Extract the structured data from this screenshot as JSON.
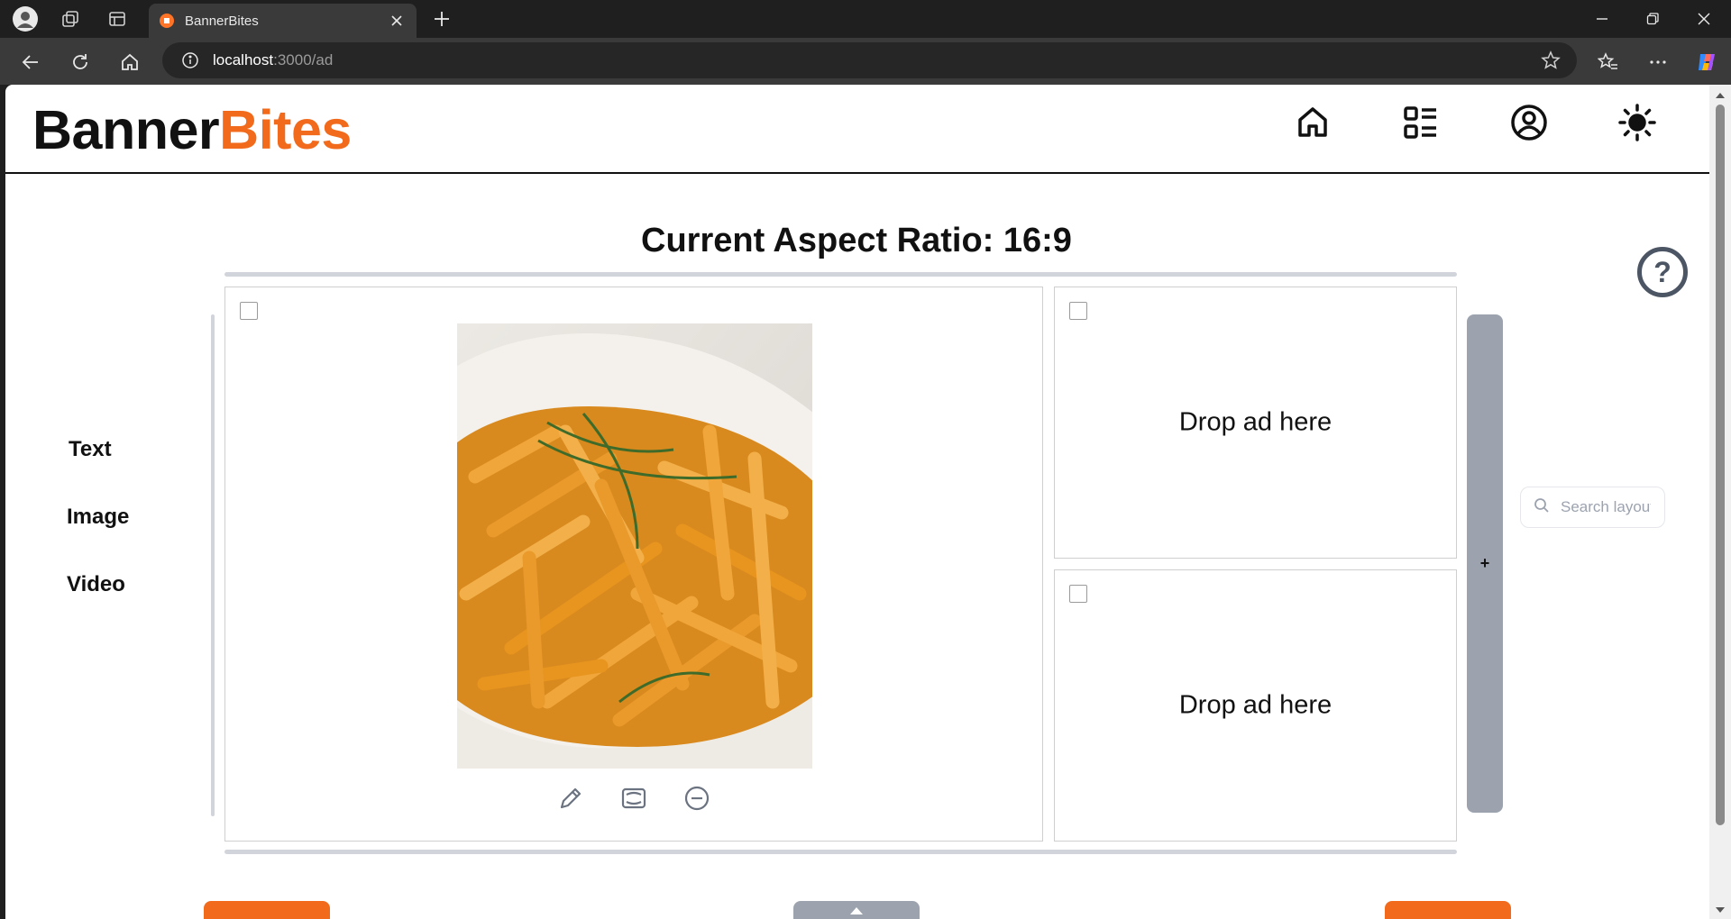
{
  "browser": {
    "tab_title": "BannerBites",
    "url_host": "localhost",
    "url_path": ":3000/ad"
  },
  "header": {
    "logo_part1": "Banner",
    "logo_part2": "Bites",
    "nav_icons": [
      "home-icon",
      "layouts-icon",
      "user-icon",
      "theme-icon"
    ]
  },
  "main": {
    "ratio_title": "Current Aspect Ratio: 16:9",
    "help_label": "?",
    "add_label": "+"
  },
  "sidebar": {
    "items": [
      {
        "label": "Text"
      },
      {
        "label": "Image"
      },
      {
        "label": "Video"
      }
    ]
  },
  "slots": [
    {
      "content": "image"
    },
    {
      "drop_text": "Drop ad here"
    },
    {
      "drop_text": "Drop ad here"
    }
  ],
  "search": {
    "placeholder": "Search layouts"
  },
  "colors": {
    "brand_orange": "#f26b1d",
    "divider_gray": "#d1d5db",
    "add_column_gray": "#9ca3af"
  }
}
